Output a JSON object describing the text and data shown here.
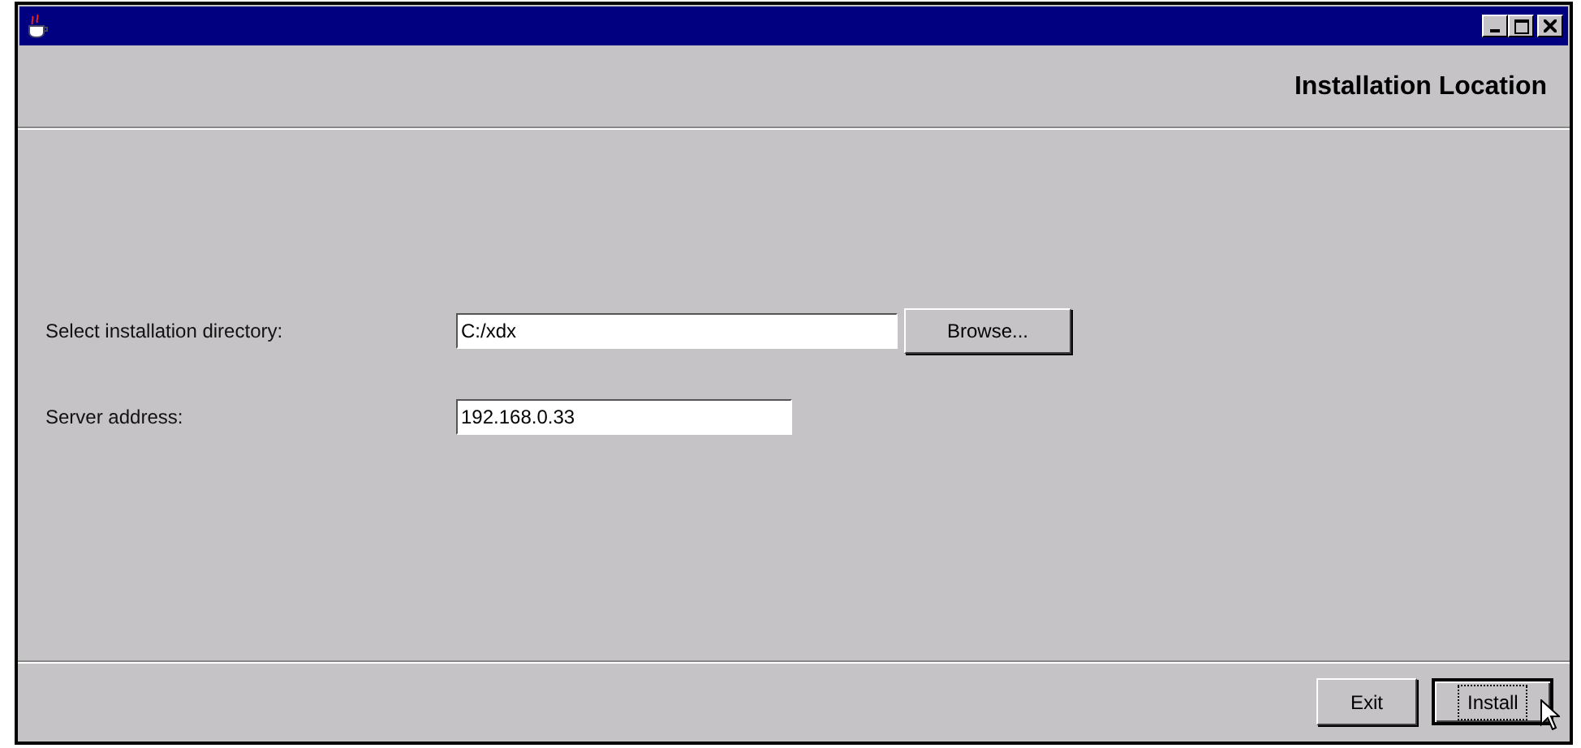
{
  "header": {
    "title": "Installation Location"
  },
  "fields": [
    {
      "label": "Select installation directory:",
      "value": "C:/xdx",
      "button": "Browse...",
      "wide": true
    },
    {
      "label": "Server address:",
      "value": "192.168.0.33",
      "wide": false
    }
  ],
  "buttons": [
    {
      "label": "Exit",
      "focused": false
    },
    {
      "label": "Install",
      "focused": true
    }
  ]
}
